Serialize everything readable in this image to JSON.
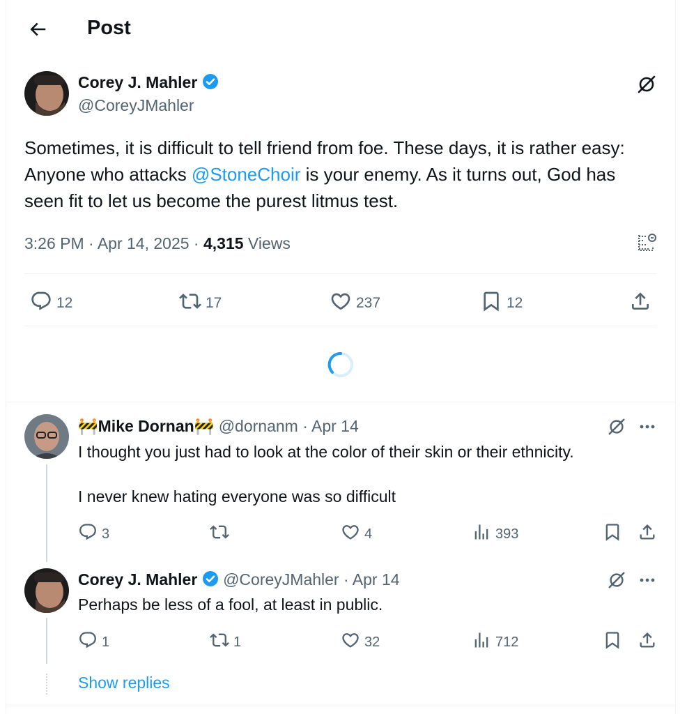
{
  "header": {
    "title": "Post"
  },
  "post": {
    "author_name": "Corey J. Mahler",
    "handle": "@CoreyJMahler",
    "text_before": "Sometimes, it is difficult to tell friend from foe. These days, it is rather easy: Anyone who attacks ",
    "mention": "@StoneChoir",
    "text_after": " is your enemy. As it turns out, God has seen fit to let us become the purest litmus test.",
    "time": "3:26 PM · Apr 14, 2025 · ",
    "views_count": "4,315",
    "views_label": " Views",
    "replies": "12",
    "reposts": "17",
    "likes": "237",
    "bookmarks": "12"
  },
  "replies": [
    {
      "name": "Mike Dornan",
      "name_emoji": "🚧",
      "handle": "@dornanm",
      "date": "· Apr 14",
      "line1": "I thought you just had to look at the color of their skin or their ethnicity.",
      "line2": "I never knew hating everyone was so difficult",
      "replies": "3",
      "reposts": "",
      "likes": "4",
      "views": "393"
    },
    {
      "name": "Corey J. Mahler",
      "handle": "@CoreyJMahler",
      "date": "· Apr 14",
      "line1": "Perhaps be less of a fool, at least in public.",
      "replies": "1",
      "reposts": "1",
      "likes": "32",
      "views": "712"
    }
  ],
  "show_replies": "Show replies",
  "colors": {
    "accent": "#1d9bf0",
    "muted": "#536471",
    "text": "#0f1419"
  },
  "icons": [
    "back-arrow-icon",
    "verified-badge-icon",
    "grok-icon",
    "reply-icon",
    "repost-icon",
    "like-icon",
    "bookmark-icon",
    "share-icon",
    "views-icon",
    "more-icon",
    "post-analytics-icon",
    "loading-spinner-icon"
  ]
}
